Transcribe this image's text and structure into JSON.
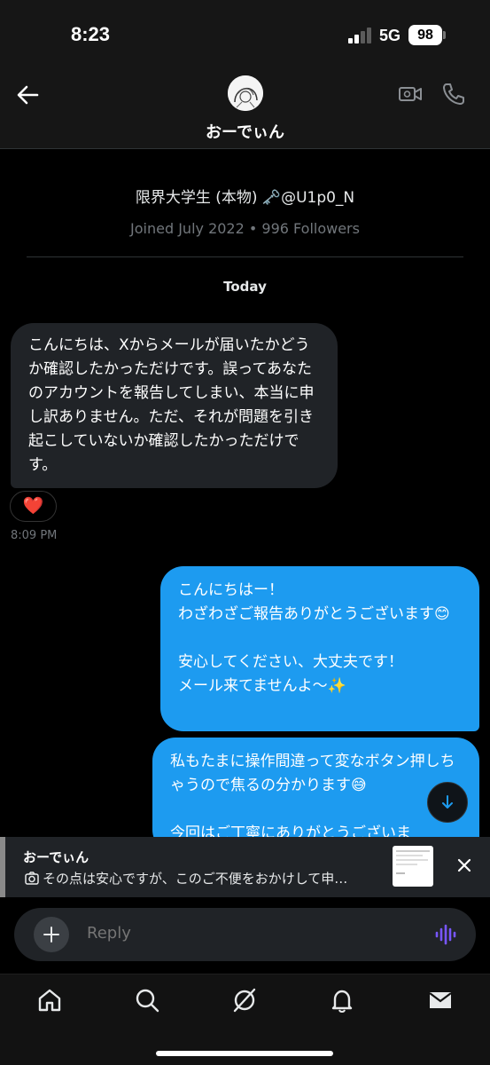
{
  "status_bar": {
    "time": "8:23",
    "network": "5G",
    "battery": "98"
  },
  "header": {
    "name": "おーでぃん"
  },
  "profile": {
    "bio_line": "限界大学生 (本物) 🗝️@U1p0_N",
    "meta": "Joined July 2022 • 996 Followers"
  },
  "date_divider": "Today",
  "messages": [
    {
      "direction": "incoming",
      "text": "こんにちは、Xからメールが届いたかどうか確認したかっただけです。誤ってあなたのアカウントを報告してしまい、本当に申し訳ありません。ただ、それが問題を引き起こしていないか確認したかっただけです。",
      "reaction": "❤️",
      "time": "8:09 PM"
    },
    {
      "direction": "outgoing",
      "text": "こんにちはー！\nわざわざご報告ありがとうございます😊\n\n安心してください、大丈夫です！\nメール来てませんよ〜✨"
    },
    {
      "direction": "outgoing",
      "text": "私もたまに操作間違って変なボタン押しちゃうので焦るの分かります😅\n\n今回はご丁寧にありがとうございま"
    }
  ],
  "notification": {
    "name": "おーでぃん",
    "text": "その点は安心ですが、このご不便をおかけして申…"
  },
  "composer": {
    "placeholder": "Reply"
  },
  "colors": {
    "accent": "#1d9bf0",
    "incoming_bubble": "#202327",
    "voice": "#7856ff"
  },
  "icons": [
    "back-arrow-icon",
    "video-call-icon",
    "phone-icon",
    "plus-icon",
    "voice-icon",
    "home-icon",
    "search-icon",
    "grok-icon",
    "bell-icon",
    "mail-icon",
    "camera-icon",
    "close-icon",
    "scroll-down-icon"
  ]
}
